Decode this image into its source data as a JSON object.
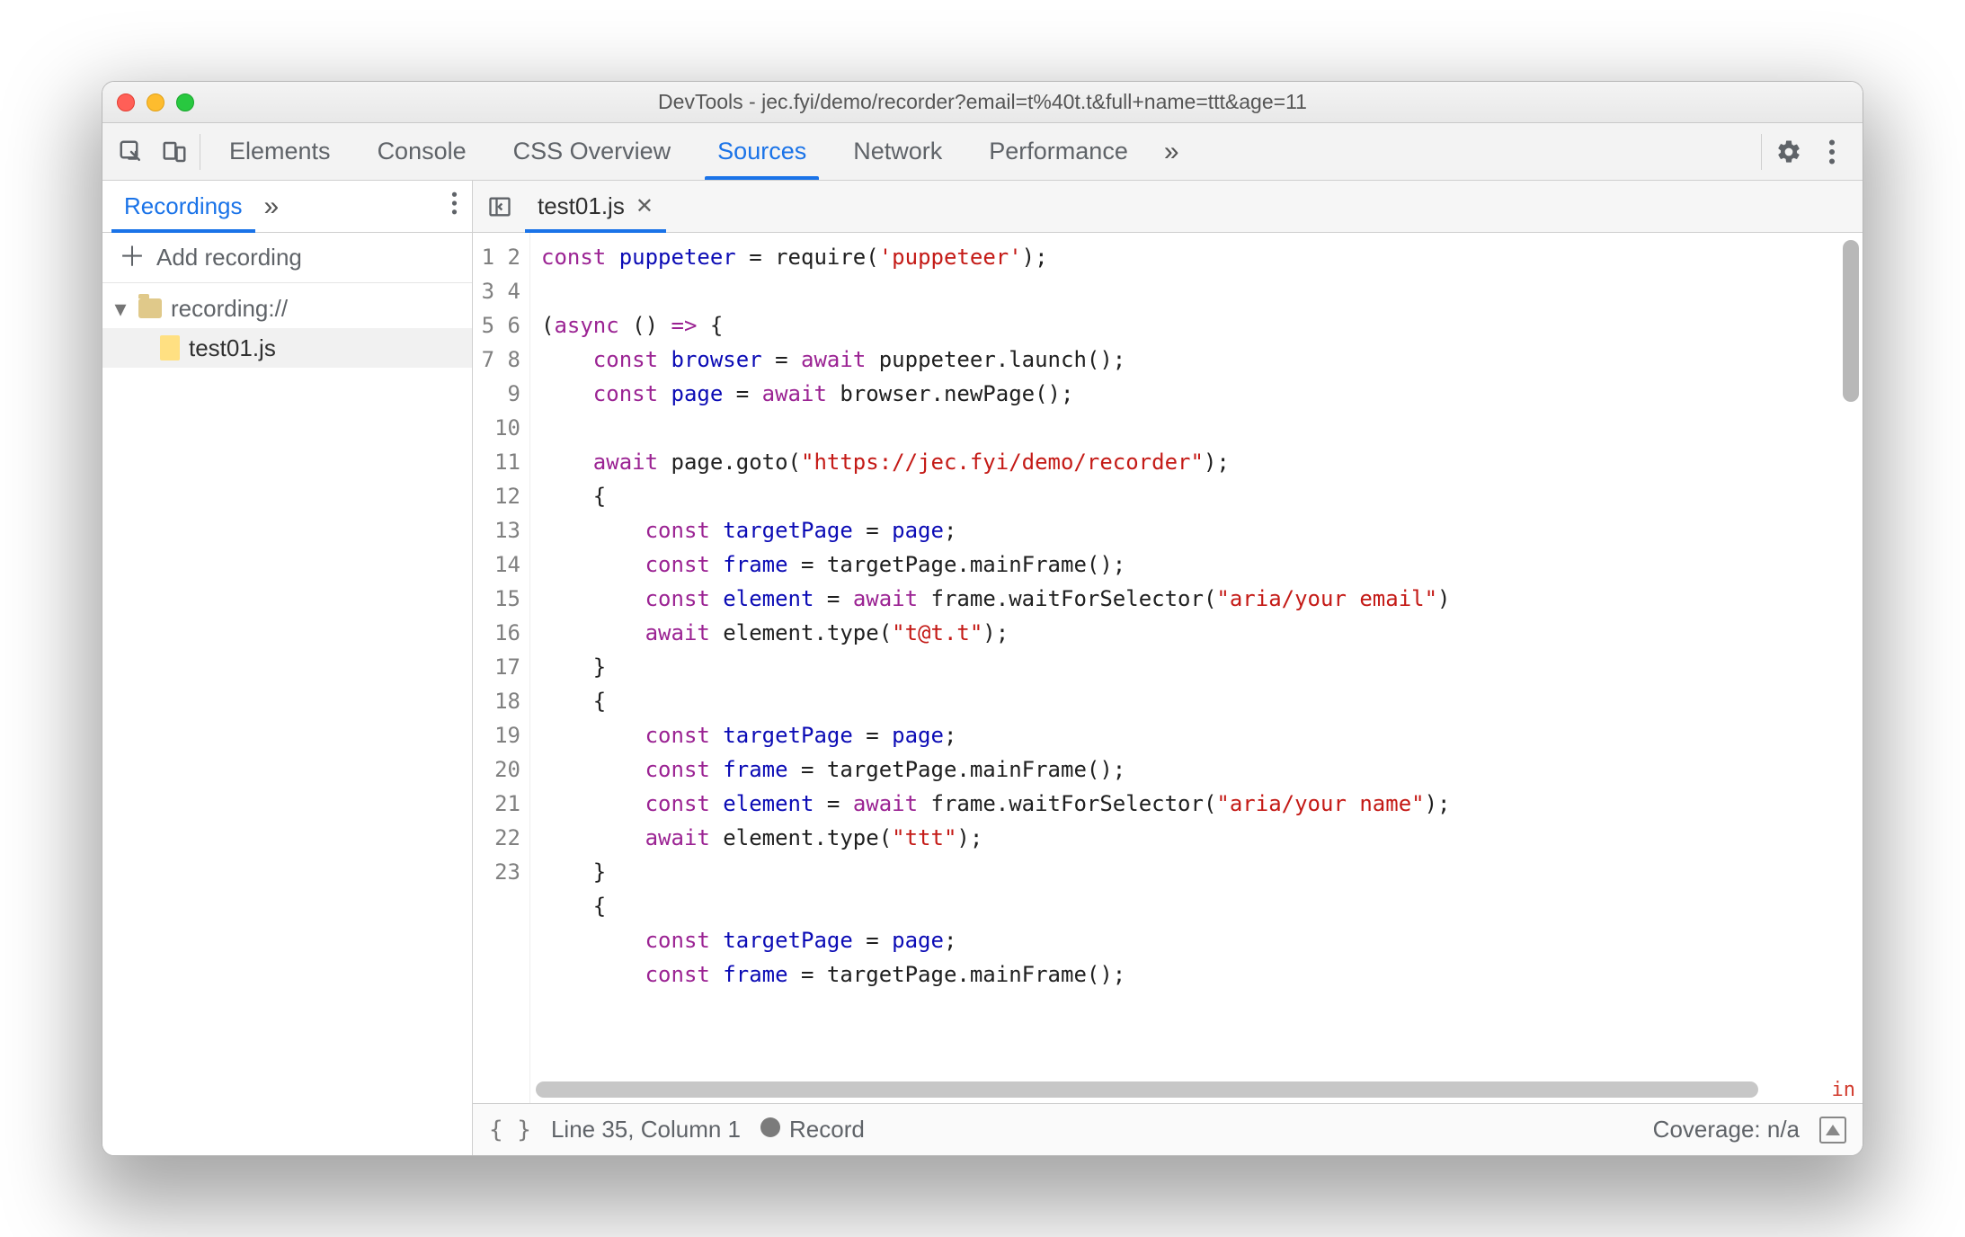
{
  "window": {
    "title": "DevTools - jec.fyi/demo/recorder?email=t%40t.t&full+name=ttt&age=11"
  },
  "toolbar_tabs": [
    "Elements",
    "Console",
    "CSS Overview",
    "Sources",
    "Network",
    "Performance"
  ],
  "toolbar_active": "Sources",
  "sidebar": {
    "tab": "Recordings",
    "add_label": "Add recording",
    "tree": {
      "folder": "recording://",
      "file": "test01.js"
    }
  },
  "editor": {
    "filename": "test01.js",
    "code_lines": [
      [
        [
          "kw",
          "const "
        ],
        [
          "id",
          "puppeteer"
        ],
        [
          "op",
          " = "
        ],
        [
          "fn",
          "require"
        ],
        [
          "op",
          "("
        ],
        [
          "str",
          "'puppeteer'"
        ],
        [
          "op",
          ");"
        ]
      ],
      [
        [
          "op",
          ""
        ]
      ],
      [
        [
          "op",
          "("
        ],
        [
          "kw",
          "async"
        ],
        [
          "op",
          " () "
        ],
        [
          "kw",
          "=>"
        ],
        [
          "op",
          " {"
        ]
      ],
      [
        [
          "op",
          "    "
        ],
        [
          "kw",
          "const "
        ],
        [
          "id",
          "browser"
        ],
        [
          "op",
          " = "
        ],
        [
          "kw",
          "await"
        ],
        [
          "op",
          " "
        ],
        [
          "fn",
          "puppeteer.launch"
        ],
        [
          "op",
          "();"
        ]
      ],
      [
        [
          "op",
          "    "
        ],
        [
          "kw",
          "const "
        ],
        [
          "id",
          "page"
        ],
        [
          "op",
          " = "
        ],
        [
          "kw",
          "await"
        ],
        [
          "op",
          " "
        ],
        [
          "fn",
          "browser.newPage"
        ],
        [
          "op",
          "();"
        ]
      ],
      [
        [
          "op",
          ""
        ]
      ],
      [
        [
          "op",
          "    "
        ],
        [
          "kw",
          "await"
        ],
        [
          "op",
          " "
        ],
        [
          "fn",
          "page.goto"
        ],
        [
          "op",
          "("
        ],
        [
          "str",
          "\"https://jec.fyi/demo/recorder\""
        ],
        [
          "op",
          ");"
        ]
      ],
      [
        [
          "op",
          "    {"
        ]
      ],
      [
        [
          "op",
          "        "
        ],
        [
          "kw",
          "const "
        ],
        [
          "id",
          "targetPage"
        ],
        [
          "op",
          " = "
        ],
        [
          "id",
          "page"
        ],
        [
          "op",
          ";"
        ]
      ],
      [
        [
          "op",
          "        "
        ],
        [
          "kw",
          "const "
        ],
        [
          "id",
          "frame"
        ],
        [
          "op",
          " = "
        ],
        [
          "fn",
          "targetPage.mainFrame"
        ],
        [
          "op",
          "();"
        ]
      ],
      [
        [
          "op",
          "        "
        ],
        [
          "kw",
          "const "
        ],
        [
          "id",
          "element"
        ],
        [
          "op",
          " = "
        ],
        [
          "kw",
          "await"
        ],
        [
          "op",
          " "
        ],
        [
          "fn",
          "frame.waitForSelector"
        ],
        [
          "op",
          "("
        ],
        [
          "str",
          "\"aria/your email\""
        ],
        [
          "op",
          ")"
        ]
      ],
      [
        [
          "op",
          "        "
        ],
        [
          "kw",
          "await"
        ],
        [
          "op",
          " "
        ],
        [
          "fn",
          "element.type"
        ],
        [
          "op",
          "("
        ],
        [
          "str",
          "\"t@t.t\""
        ],
        [
          "op",
          ");"
        ]
      ],
      [
        [
          "op",
          "    }"
        ]
      ],
      [
        [
          "op",
          "    {"
        ]
      ],
      [
        [
          "op",
          "        "
        ],
        [
          "kw",
          "const "
        ],
        [
          "id",
          "targetPage"
        ],
        [
          "op",
          " = "
        ],
        [
          "id",
          "page"
        ],
        [
          "op",
          ";"
        ]
      ],
      [
        [
          "op",
          "        "
        ],
        [
          "kw",
          "const "
        ],
        [
          "id",
          "frame"
        ],
        [
          "op",
          " = "
        ],
        [
          "fn",
          "targetPage.mainFrame"
        ],
        [
          "op",
          "();"
        ]
      ],
      [
        [
          "op",
          "        "
        ],
        [
          "kw",
          "const "
        ],
        [
          "id",
          "element"
        ],
        [
          "op",
          " = "
        ],
        [
          "kw",
          "await"
        ],
        [
          "op",
          " "
        ],
        [
          "fn",
          "frame.waitForSelector"
        ],
        [
          "op",
          "("
        ],
        [
          "str",
          "\"aria/your name\""
        ],
        [
          "op",
          ");"
        ]
      ],
      [
        [
          "op",
          "        "
        ],
        [
          "kw",
          "await"
        ],
        [
          "op",
          " "
        ],
        [
          "fn",
          "element.type"
        ],
        [
          "op",
          "("
        ],
        [
          "str",
          "\"ttt\""
        ],
        [
          "op",
          ");"
        ]
      ],
      [
        [
          "op",
          "    }"
        ]
      ],
      [
        [
          "op",
          "    {"
        ]
      ],
      [
        [
          "op",
          "        "
        ],
        [
          "kw",
          "const "
        ],
        [
          "id",
          "targetPage"
        ],
        [
          "op",
          " = "
        ],
        [
          "id",
          "page"
        ],
        [
          "op",
          ";"
        ]
      ],
      [
        [
          "op",
          "        "
        ],
        [
          "kw",
          "const "
        ],
        [
          "id",
          "frame"
        ],
        [
          "op",
          " = "
        ],
        [
          "fn",
          "targetPage.mainFrame"
        ],
        [
          "op",
          "();"
        ]
      ]
    ],
    "last_line_partial": "23",
    "bottom_red": "in"
  },
  "status": {
    "position": "Line 35, Column 1",
    "record": "Record",
    "coverage": "Coverage: n/a"
  }
}
